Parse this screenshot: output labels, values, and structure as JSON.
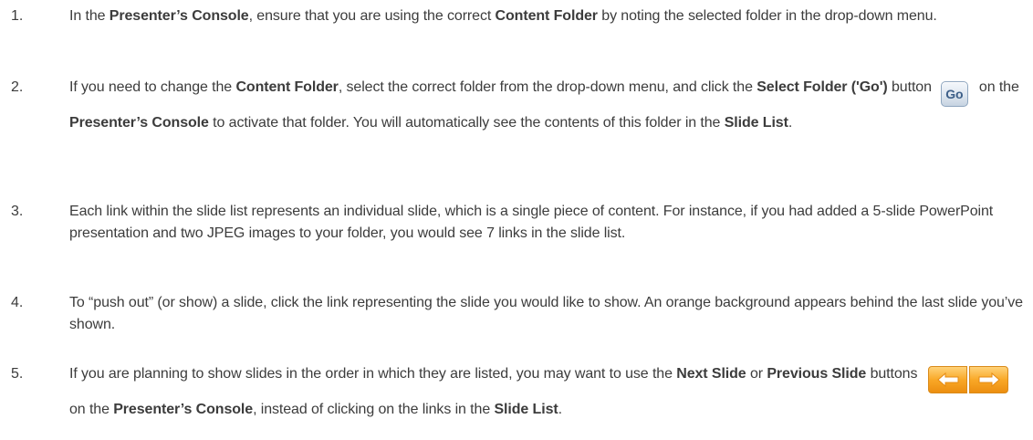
{
  "steps": [
    {
      "number": "1.",
      "t1": "In the ",
      "b1": "Presenter’s Console",
      "t2": ", ensure that you are using the correct ",
      "b2": "Content Folder",
      "t3": " by noting the selected folder in the drop-down menu."
    },
    {
      "number": "2.",
      "t1": "If you need to change the ",
      "b1": "Content Folder",
      "t2": ", select the correct folder from the drop-down menu, and click the ",
      "b2": "Select Folder ('Go')",
      "t3": " button",
      "go_label": "Go",
      "t4": "on the ",
      "b3": "Presenter’s Console",
      "t5": " to activate that folder.  You will automatically see the contents of this folder in the ",
      "b4": "Slide List",
      "t6": "."
    },
    {
      "number": "3.",
      "text": "Each link within the slide list represents an individual slide, which is a single piece of content.  For instance, if you had added a 5-slide PowerPoint presentation and two JPEG images to your folder, you would see 7 links in the slide list."
    },
    {
      "number": "4.",
      "text": "To “push out” (or show) a slide, click the link representing the slide you would like to show.  An orange background appears behind the last slide you’ve shown."
    },
    {
      "number": "5.",
      "t1": "If you are planning to show slides in the order in which they are listed, you may want to use the ",
      "b1": "Next Slide",
      "t2": " or ",
      "b2": "Previous Slide",
      "t3": " buttons",
      "t4": "on the ",
      "b3": "Presenter’s Console",
      "t5": ", instead of clicking on the links in the ",
      "b4": "Slide List",
      "t6": "."
    }
  ],
  "icons": {
    "go_button": "go-button-icon",
    "previous": "left-arrow-icon",
    "next": "right-arrow-icon"
  },
  "colors": {
    "text": "#3c3c3c",
    "go_text": "#3d5f88",
    "nav_orange": "#f9a827"
  }
}
